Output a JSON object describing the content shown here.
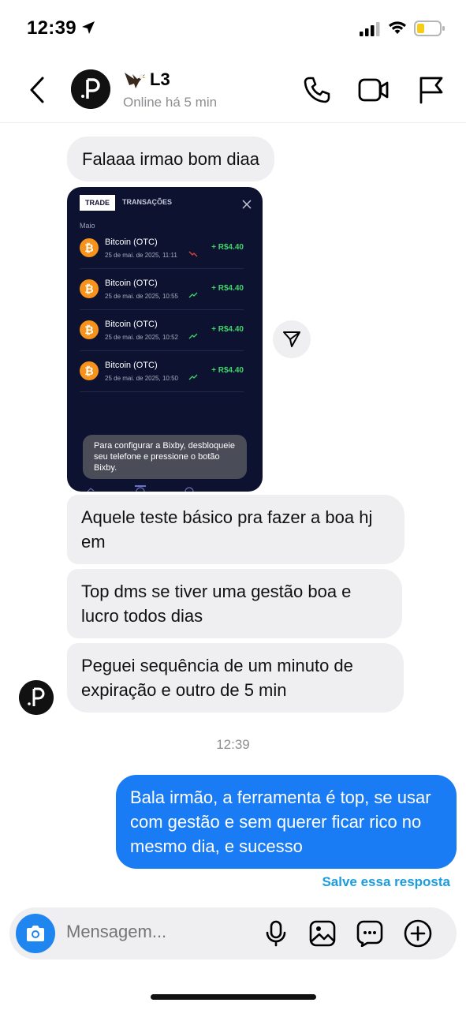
{
  "status_bar": {
    "time": "12:39"
  },
  "header": {
    "contact_name": "L3",
    "contact_status": "Online há 5 min"
  },
  "messages": {
    "m1": "Falaaa irmao bom diaa",
    "m2": "Aquele teste básico pra fazer a boa hj em",
    "m3": "Top dms se tiver uma gestão boa e lucro todos dias",
    "m4": "Peguei sequência de um minuto de expiração e outro de 5 min",
    "m5": "Bala irmão, a ferramenta é top, se usar com gestão e sem querer ficar rico no mesmo dia, e sucesso"
  },
  "timestamp": "12:39",
  "save_reply_link": "Salve essa resposta",
  "screenshot": {
    "tab_trade": "TRADE",
    "tab_transactions": "TRANSAÇÕES",
    "month": "Maio",
    "trades": [
      {
        "asset": "Bitcoin (OTC)",
        "date": "25 de mai. de 2025, 11:11",
        "amount": "+ R$4.40",
        "trend": "down"
      },
      {
        "asset": "Bitcoin (OTC)",
        "date": "25 de mai. de 2025, 10:55",
        "amount": "+ R$4.40",
        "trend": "up"
      },
      {
        "asset": "Bitcoin (OTC)",
        "date": "25 de mai. de 2025, 10:52",
        "amount": "+ R$4.40",
        "trend": "up"
      },
      {
        "asset": "Bitcoin (OTC)",
        "date": "25 de mai. de 2025, 10:50",
        "amount": "+ R$4.40",
        "trend": "up"
      }
    ],
    "toast": "Para configurar a Bixby, desbloqueie seu telefone e pressione o botão Bixby."
  },
  "composer": {
    "placeholder": "Mensagem..."
  },
  "colors": {
    "outgoing_bubble": "#1a7cf5",
    "incoming_bubble": "#efeff1",
    "link": "#1a9cde",
    "profit_green": "#3fd46a",
    "bitcoin_orange": "#f7931a"
  }
}
